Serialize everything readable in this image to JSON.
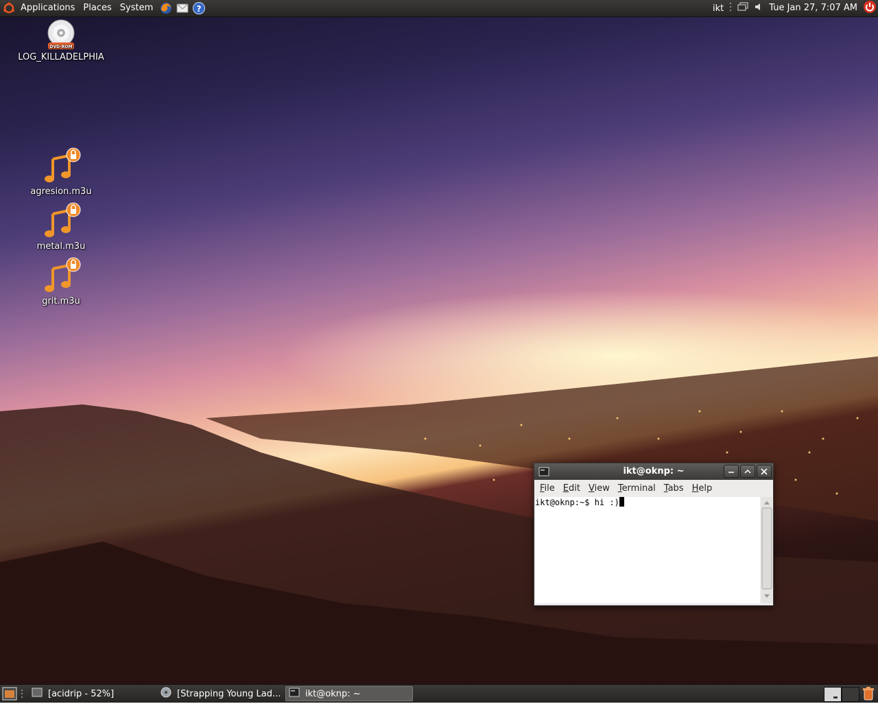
{
  "top_panel": {
    "menus": [
      "Applications",
      "Places",
      "System"
    ],
    "launchers": [
      "firefox-icon",
      "mail-icon",
      "help-icon"
    ],
    "user": "ikt",
    "clock": "Tue Jan 27,  7:07 AM"
  },
  "desktop_icons": [
    {
      "label": "LOG_KILLADELPHIA",
      "kind": "dvd-icon",
      "badge": "DVD-ROM"
    },
    {
      "label": "agresion.m3u",
      "kind": "playlist-icon"
    },
    {
      "label": "metal.m3u",
      "kind": "playlist-icon"
    },
    {
      "label": "grit.m3u",
      "kind": "playlist-icon"
    }
  ],
  "terminal": {
    "title": "ikt@oknp: ~",
    "menus": [
      "File",
      "Edit",
      "View",
      "Terminal",
      "Tabs",
      "Help"
    ],
    "prompt_line": "ikt@oknp:~$ hi :)"
  },
  "taskbar": {
    "tasks": [
      {
        "label": "[acidrip - 52%]",
        "active": false
      },
      {
        "label": "[Strapping Young Lad...",
        "active": false
      },
      {
        "label": "ikt@oknp: ~",
        "active": true
      }
    ]
  },
  "colors": {
    "panel": "#2f2e2c",
    "ubuntu_orange": "#e95420",
    "playlist_orange": "#f0962a",
    "shutdown_red": "#d7301f"
  }
}
